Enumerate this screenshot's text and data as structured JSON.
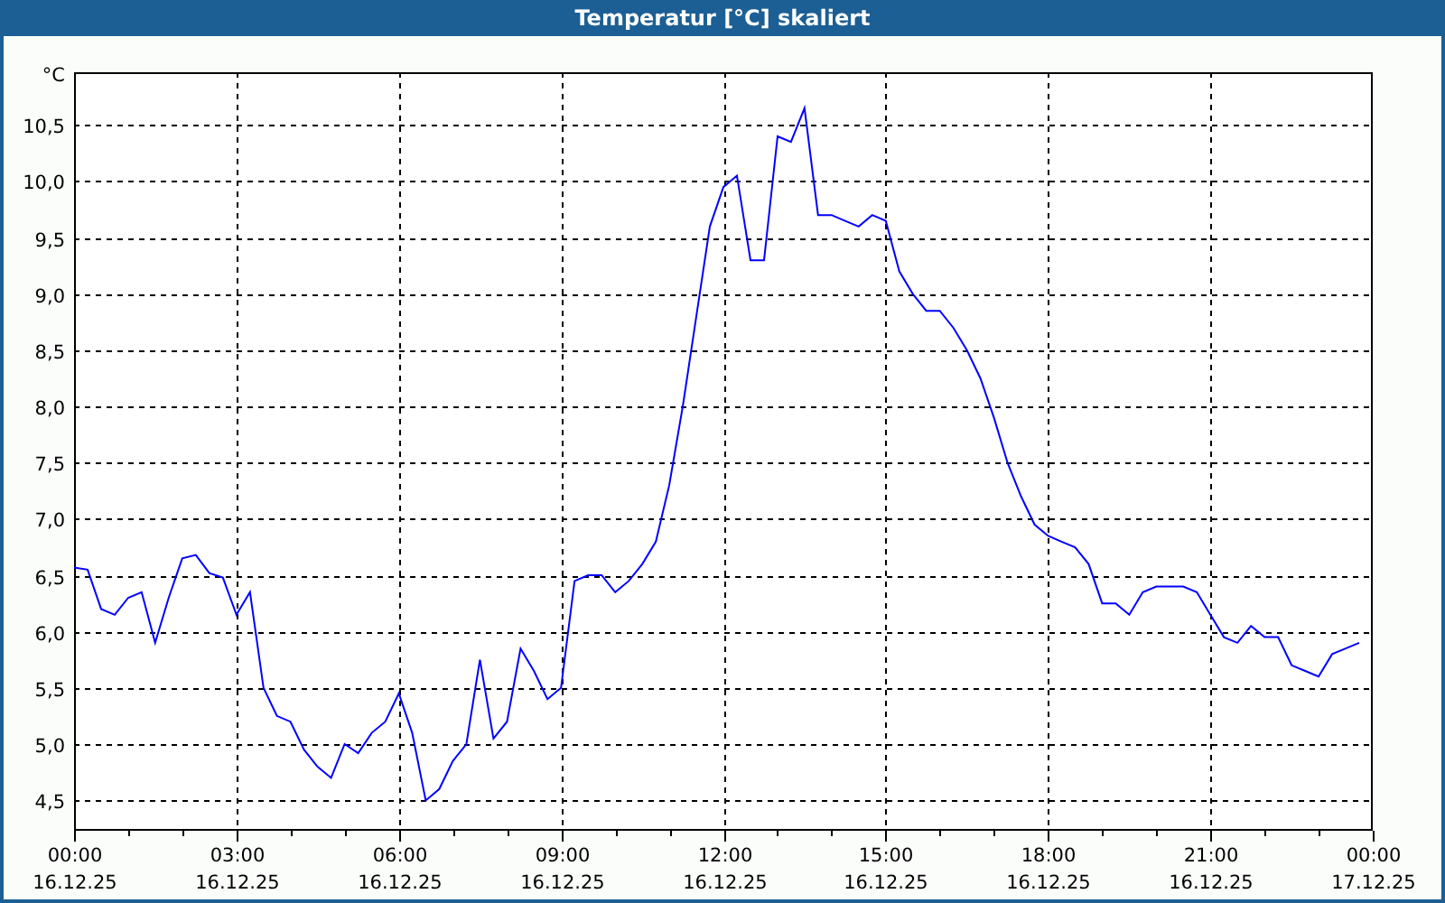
{
  "window": {
    "title": "Temperatur [°C] skaliert"
  },
  "chart": {
    "chart_data": {
      "type": "line",
      "grid": true,
      "ylabel": "°C",
      "ylim": [
        4.23,
        10.97
      ],
      "categories": [
        "00:00 16.12.25",
        null,
        null,
        null,
        null,
        null,
        null,
        null,
        null,
        null,
        null,
        null,
        "03:00 16.12.25",
        null,
        null,
        null,
        null,
        null,
        null,
        null,
        null,
        null,
        null,
        null,
        "06:00 16.12.25",
        null,
        null,
        null,
        null,
        null,
        null,
        null,
        null,
        null,
        null,
        null,
        "09:00 16.12.25",
        null,
        null,
        null,
        null,
        null,
        null,
        null,
        null,
        null,
        null,
        null,
        "12:00 16.12.25",
        null,
        null,
        null,
        null,
        null,
        null,
        null,
        null,
        null,
        null,
        null,
        "15:00 16.12.25",
        null,
        null,
        null,
        null,
        null,
        null,
        null,
        null,
        null,
        null,
        null,
        "18:00 16.12.25",
        null,
        null,
        null,
        null,
        null,
        null,
        null,
        null,
        null,
        null,
        null,
        "21:00 16.12.25",
        null,
        null,
        null,
        null,
        null,
        null,
        null,
        null,
        null,
        null,
        null,
        "00:00 17.12.25"
      ],
      "series": [
        {
          "color": "#0000ff",
          "values": [
            6.57,
            6.55,
            6.2,
            6.15,
            6.3,
            6.35,
            5.9,
            6.3,
            6.65,
            6.68,
            6.52,
            6.48,
            6.15,
            6.35,
            5.5,
            5.25,
            5.2,
            4.95,
            4.8,
            4.7,
            5.0,
            4.92,
            5.1,
            5.2,
            5.45,
            5.1,
            4.5,
            4.6,
            4.85,
            5.0,
            5.75,
            5.05,
            5.2,
            5.85,
            5.65,
            5.4,
            5.5,
            6.45,
            6.5,
            6.5,
            6.35,
            6.45,
            6.6,
            6.8,
            7.3,
            8.0,
            8.8,
            9.6,
            9.95,
            10.05,
            9.3,
            9.3,
            10.4,
            10.35,
            10.65,
            9.7,
            9.7,
            9.65,
            9.6,
            9.7,
            9.65,
            9.2,
            9.0,
            8.85,
            8.85,
            8.7,
            8.5,
            8.25,
            7.9,
            7.5,
            7.2,
            6.95,
            6.85,
            6.8,
            6.75,
            6.6,
            6.25,
            6.25,
            6.15,
            6.35,
            6.4,
            6.4,
            6.4,
            6.35,
            6.15,
            5.95,
            5.9,
            6.05,
            5.95,
            5.95,
            5.7,
            5.65,
            5.6,
            5.8,
            5.85,
            5.9,
            null
          ]
        }
      ],
      "yticks": [
        {
          "value": 4.5,
          "label": "4,5"
        },
        {
          "value": 5,
          "label": "5,0"
        },
        {
          "value": 5.5,
          "label": "5,5"
        },
        {
          "value": 6,
          "label": "6,0"
        },
        {
          "value": 6.5,
          "label": "6,5"
        },
        {
          "value": 7,
          "label": "7,0"
        },
        {
          "value": 7.5,
          "label": "7,5"
        },
        {
          "value": 8,
          "label": "8,0"
        },
        {
          "value": 8.5,
          "label": "8,5"
        },
        {
          "value": 9,
          "label": "9,0"
        },
        {
          "value": 9.5,
          "label": "9,5"
        },
        {
          "value": 10,
          "label": "10,0"
        },
        {
          "value": 10.5,
          "label": "10,5"
        }
      ]
    }
  }
}
